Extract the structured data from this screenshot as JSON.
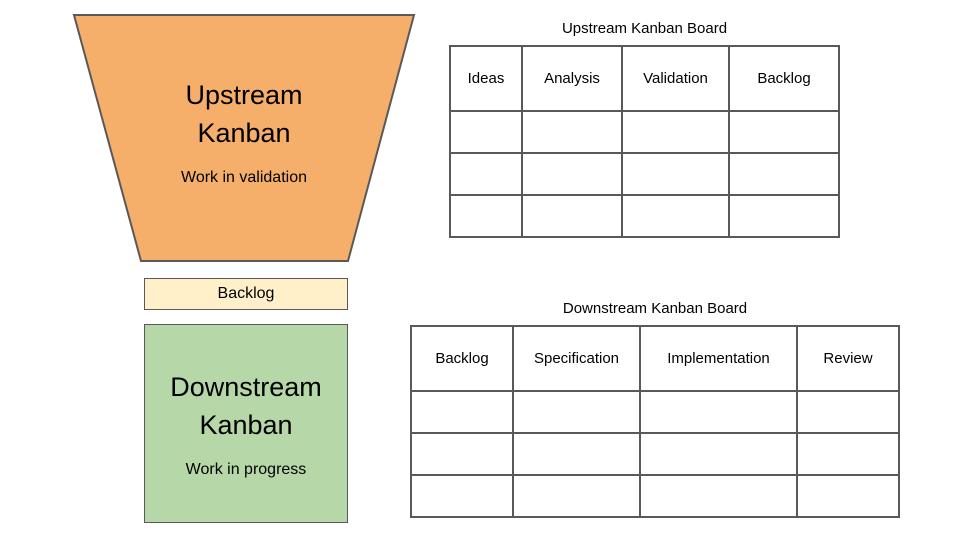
{
  "diagram": {
    "upstream_shape": {
      "title": "Upstream\nKanban",
      "subtitle": "Work in validation",
      "fill_color": "#F5AF6A",
      "stroke_color": "#595959"
    },
    "connector": {
      "label": "Backlog",
      "fill_color": "#FFF0C9",
      "stroke_color": "#595959"
    },
    "downstream_shape": {
      "title": "Downstream\nKanban",
      "subtitle": "Work in progress",
      "fill_color": "#B6D7A8",
      "stroke_color": "#595959"
    },
    "upstream_board": {
      "title": "Upstream Kanban Board",
      "columns": [
        "Ideas",
        "Analysis",
        "Validation",
        "Backlog"
      ],
      "rows": [
        [
          "",
          "",
          "",
          ""
        ],
        [
          "",
          "",
          "",
          ""
        ],
        [
          "",
          "",
          "",
          ""
        ]
      ]
    },
    "downstream_board": {
      "title": "Downstream Kanban Board",
      "columns": [
        "Backlog",
        "Specification",
        "Implementation",
        "Review"
      ],
      "rows": [
        [
          "",
          "",
          "",
          ""
        ],
        [
          "",
          "",
          "",
          ""
        ],
        [
          "",
          "",
          "",
          ""
        ]
      ]
    }
  }
}
